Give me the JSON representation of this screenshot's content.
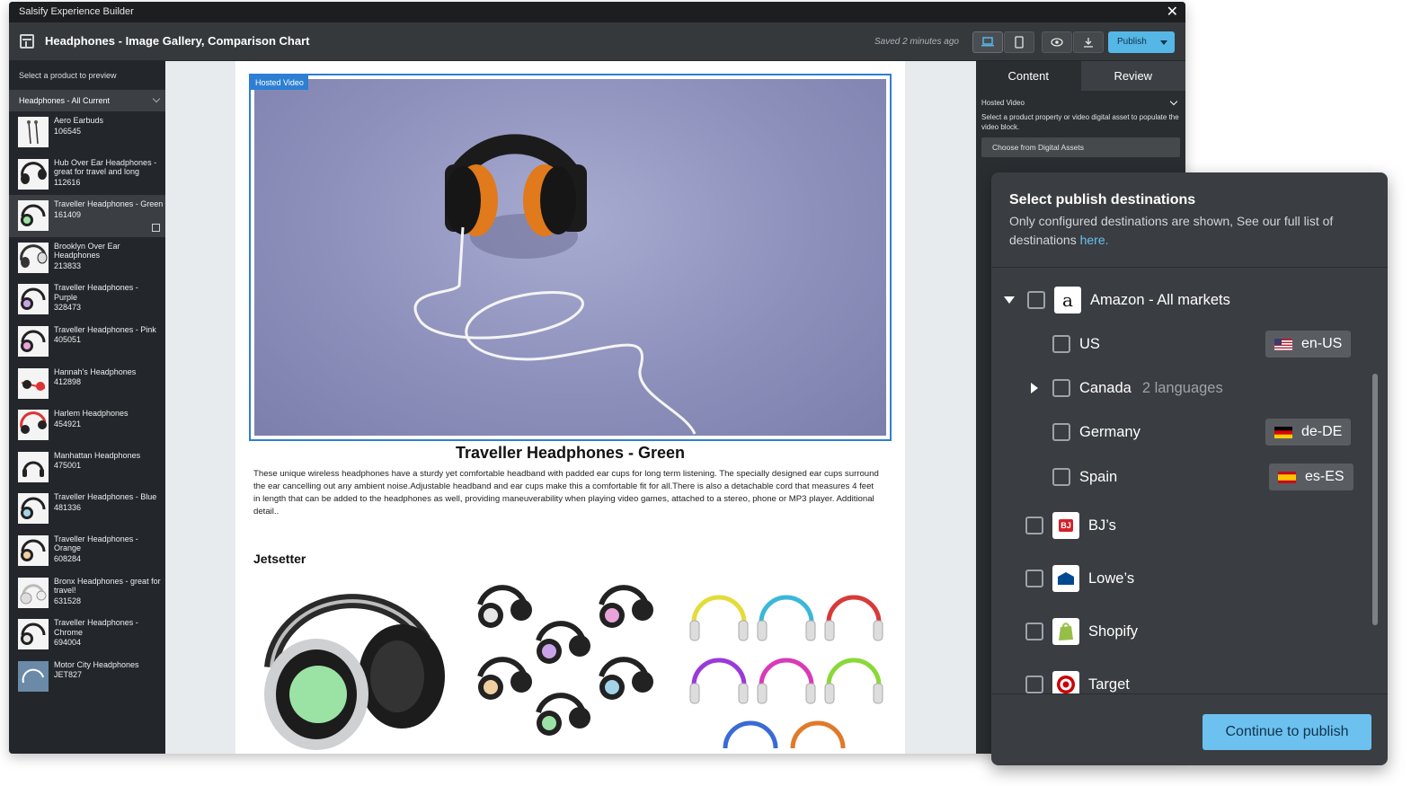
{
  "window": {
    "title": "Salsify Experience Builder"
  },
  "toolbar": {
    "doc_title": "Headphones - Image Gallery, Comparison Chart",
    "saved_status": "Saved 2 minutes ago",
    "publish_label": "Publish"
  },
  "sidebar": {
    "prompt": "Select a product to preview",
    "selected_list": "Headphones - All Current",
    "products": [
      {
        "name": "Aero Earbuds",
        "sku": "106545"
      },
      {
        "name": "Hub Over Ear Headphones - great for travel and long",
        "sku": "112616"
      },
      {
        "name": "Traveller Headphones - Green",
        "sku": "161409"
      },
      {
        "name": "Brooklyn Over Ear Headphones",
        "sku": "213833"
      },
      {
        "name": "Traveller Headphones - Purple",
        "sku": "328473"
      },
      {
        "name": "Traveller Headphones - Pink",
        "sku": "405051"
      },
      {
        "name": "Hannah's Headphones",
        "sku": "412898"
      },
      {
        "name": "Harlem Headphones",
        "sku": "454921"
      },
      {
        "name": "Manhattan Headphones",
        "sku": "475001"
      },
      {
        "name": "Traveller Headphones - Blue",
        "sku": "481336"
      },
      {
        "name": "Traveller Headphones - Orange",
        "sku": "608284"
      },
      {
        "name": "Bronx Headphones - great for travel!",
        "sku": "631528"
      },
      {
        "name": "Traveller Headphones - Chrome",
        "sku": "694004"
      },
      {
        "name": "Motor City Headphones",
        "sku": "JET827"
      }
    ]
  },
  "canvas": {
    "video_tag": "Hosted Video",
    "product_title": "Traveller Headphones - Green",
    "description": "These unique wireless headphones have a sturdy yet comfortable headband with padded ear cups for long term listening. The specially designed ear cups surround the ear cancelling out any ambient noise.Adjustable headband and ear cups make this a comfortable fit for all.There is also a detachable cord that measures 4 feet in length that can be added to the headphones as well, providing maneuverability when playing video games, attached to a stereo, phone or MP3 player. Additional detail..",
    "section_title": "Jetsetter"
  },
  "right_panel": {
    "tabs": [
      "Content",
      "Review"
    ],
    "section_label": "Hosted Video",
    "help_text": "Select a product property or video digital asset to populate the video block.",
    "source_select": "Choose from Digital Assets"
  },
  "publish_modal": {
    "title": "Select publish destinations",
    "subtitle": "Only configured destinations are shown, See our full list of destinations",
    "link_text": "here.",
    "destinations": {
      "amazon": "Amazon - All markets",
      "us": "US",
      "us_locale": "en-US",
      "canada": "Canada",
      "canada_sub": "2 languages",
      "germany": "Germany",
      "germany_locale": "de-DE",
      "spain": "Spain",
      "spain_locale": "es-ES",
      "bjs": "BJ’s",
      "lowes": "Lowe’s",
      "shopify": "Shopify",
      "target": "Target"
    },
    "continue_label": "Continue to publish"
  },
  "colors": {
    "accent_blue": "#55b7e6",
    "selection_blue": "#2d7fd3",
    "modal_bg": "#3a3d41",
    "link": "#6cc1ef"
  }
}
